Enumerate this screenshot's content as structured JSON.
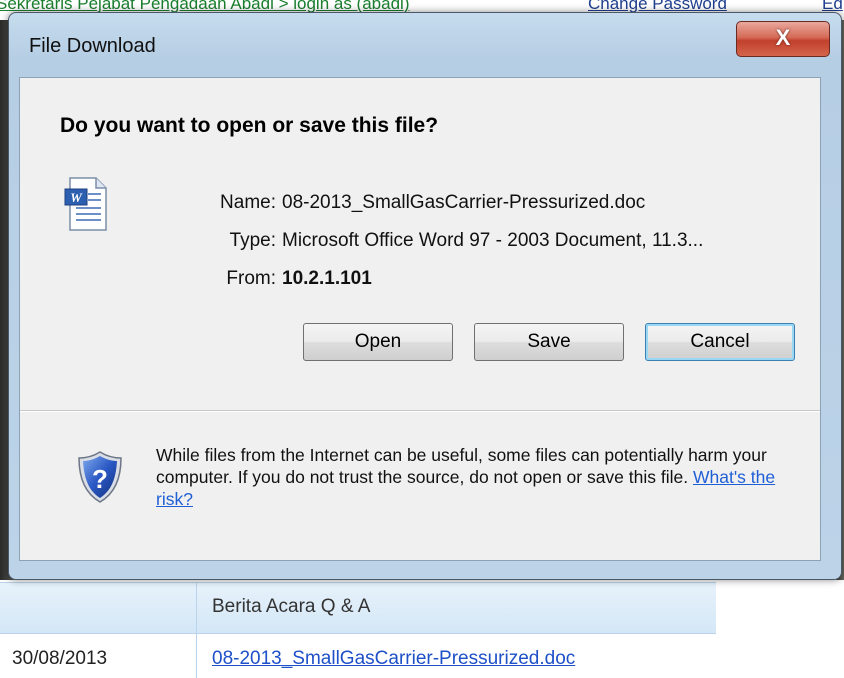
{
  "background": {
    "top_link_left": "Sekretaris Pejabat Pengadaan Abadi > login as (abadi)",
    "top_link_right": "Change Password",
    "top_link_far": "Ed",
    "table_header": "Berita Acara Q & A",
    "row_date": "30/08/2013",
    "row_file": "08-2013_SmallGasCarrier-Pressurized.doc"
  },
  "dialog": {
    "title": "File Download",
    "close_label": "X",
    "question": "Do you want to open or save this file?",
    "file_icon": "word-document-icon",
    "fields": {
      "name_label": "Name:",
      "name_value": "08-2013_SmallGasCarrier-Pressurized.doc",
      "type_label": "Type:",
      "type_value": "Microsoft Office Word 97 - 2003 Document, 11.3...",
      "from_label": "From:",
      "from_value": "10.2.1.101"
    },
    "buttons": {
      "open": "Open",
      "save": "Save",
      "cancel": "Cancel"
    },
    "warning": {
      "icon": "security-shield-question-icon",
      "text": "While files from the Internet can be useful, some files can potentially harm your computer. If you do not trust the source, do not open or save this file. ",
      "link": "What's the risk?"
    }
  },
  "colors": {
    "link": "#1f5fd6",
    "close_button": "#c1412d",
    "default_button_glow": "#9ad7f5",
    "table_header_bg": "#d4e7f7"
  }
}
